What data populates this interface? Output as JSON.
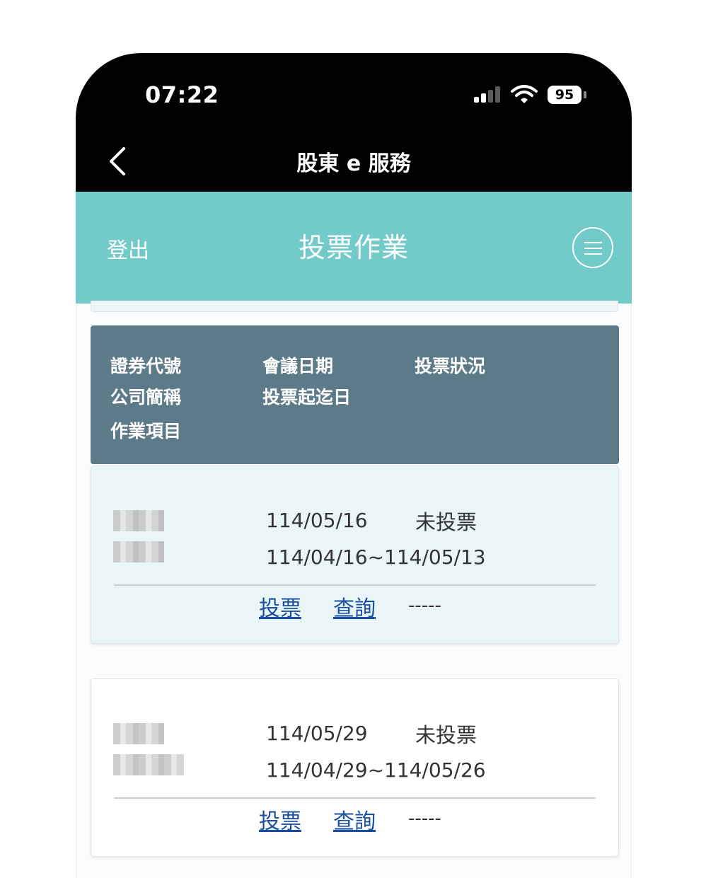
{
  "status_bar": {
    "time": "07:22",
    "battery": "95"
  },
  "nav": {
    "title": "股東 e 服務"
  },
  "header": {
    "logout_label": "登出",
    "title": "投票作業"
  },
  "table": {
    "headers": {
      "col1": [
        "證券代號",
        "公司簡稱",
        "作業項目"
      ],
      "col2": [
        "會議日期",
        "投票起迄日"
      ],
      "col3": [
        "投票狀況"
      ]
    },
    "rows": [
      {
        "meeting_date": "114/05/16",
        "status": "未投票",
        "vote_period": "114/04/16~114/05/13",
        "vote_link": "投票",
        "query_link": "查詢",
        "extra": "-----"
      },
      {
        "meeting_date": "114/05/29",
        "status": "未投票",
        "vote_period": "114/04/29~114/05/26",
        "vote_link": "投票",
        "query_link": "查詢",
        "extra": "-----"
      }
    ]
  },
  "colors": {
    "header_teal": "#72cbc9",
    "table_header": "#5d7a88",
    "highlight_row": "#eaf5f8",
    "link": "#1a4fa0"
  },
  "icons": [
    "back-chevron-icon",
    "cellular-signal-icon",
    "wifi-icon",
    "battery-icon",
    "hamburger-menu-icon"
  ]
}
